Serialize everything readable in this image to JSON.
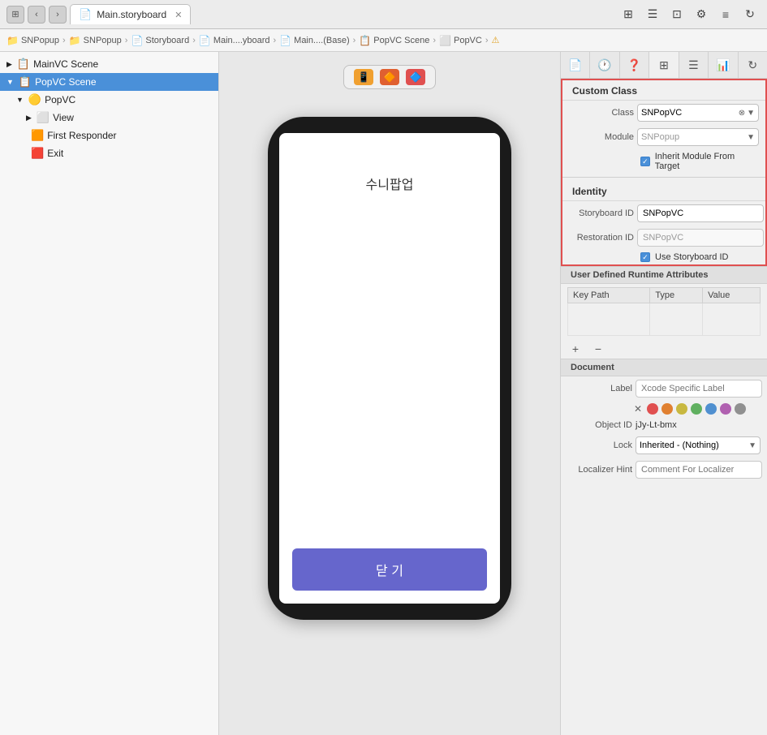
{
  "topbar": {
    "nav_back": "‹",
    "nav_fwd": "›",
    "tab_label": "Main.storyboard",
    "tab_icon": "📄",
    "icons": [
      "⊞",
      "☰",
      "⊡",
      "⚙",
      "⬛",
      "↻"
    ]
  },
  "breadcrumb": {
    "items": [
      "SNPopup",
      "SNPopup",
      "Storyboard",
      "Main....yboard",
      "Main....(Base)",
      "PopVC Scene",
      "PopVC"
    ]
  },
  "sidebar": {
    "sections": [
      {
        "label": "MainVC Scene",
        "indent": 0,
        "icon": "📋",
        "chevron": "▶"
      },
      {
        "label": "PopVC Scene",
        "indent": 0,
        "icon": "📋",
        "chevron": "▼",
        "selected": true
      },
      {
        "label": "PopVC",
        "indent": 1,
        "icon": "🟡",
        "chevron": "▼"
      },
      {
        "label": "View",
        "indent": 2,
        "icon": "⬜",
        "chevron": "▶"
      },
      {
        "label": "First Responder",
        "indent": 1,
        "icon": "🟧"
      },
      {
        "label": "Exit",
        "indent": 1,
        "icon": "🟥"
      }
    ]
  },
  "phone": {
    "popup_text": "수니팝업",
    "close_btn": "닫 기"
  },
  "right_panel": {
    "tabs": [
      "📄",
      "🕐",
      "❓",
      "⊞",
      "☰",
      "📊",
      "↻"
    ],
    "custom_class": {
      "title": "Custom Class",
      "class_label": "Class",
      "class_value": "SNPopVC",
      "module_label": "Module",
      "module_value": "SNPopup",
      "inherit_label": "Inherit Module From Target",
      "inherit_checked": true
    },
    "identity": {
      "title": "Identity",
      "storyboard_id_label": "Storyboard ID",
      "storyboard_id_value": "SNPopVC",
      "restoration_id_label": "Restoration ID",
      "restoration_id_value": "SNPopVC",
      "use_storyboard_label": "Use Storyboard ID",
      "use_storyboard_checked": true
    },
    "user_defined": {
      "title": "User Defined Runtime Attributes",
      "columns": [
        "Key Path",
        "Type",
        "Value"
      ],
      "rows": [],
      "add_btn": "+",
      "remove_btn": "−"
    },
    "document": {
      "title": "Document",
      "label_label": "Label",
      "label_placeholder": "Xcode Specific Label",
      "colors": [
        "#e05050",
        "#e08030",
        "#e0d050",
        "#60c060",
        "#5090e0",
        "#c060c0",
        "#888888"
      ],
      "object_id_label": "Object ID",
      "object_id_value": "jJy-Lt-bmx",
      "lock_label": "Lock",
      "lock_value": "Inherited - (Nothing)",
      "localizer_label": "Localizer Hint",
      "localizer_placeholder": "Comment For Localizer"
    }
  }
}
